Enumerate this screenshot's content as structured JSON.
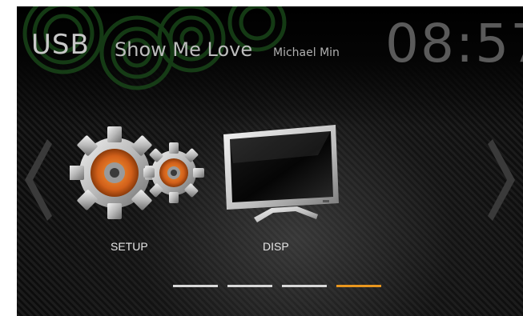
{
  "header": {
    "source": "USB",
    "song_title": "Show Me Love",
    "artist": "Michael Min",
    "clock": "08:57"
  },
  "menu": {
    "items": [
      {
        "label": "SETUP",
        "icon": "gears-icon"
      },
      {
        "label": "DISP",
        "icon": "monitor-icon"
      }
    ]
  },
  "navigation": {
    "prev_icon": "chevron-left-icon",
    "next_icon": "chevron-right-icon"
  },
  "pager": {
    "pages": 4,
    "current_page": 4
  },
  "colors": {
    "accent": "#e8961e",
    "ring_green": "#1f5a1f",
    "gear_orange": "#e0701a"
  }
}
